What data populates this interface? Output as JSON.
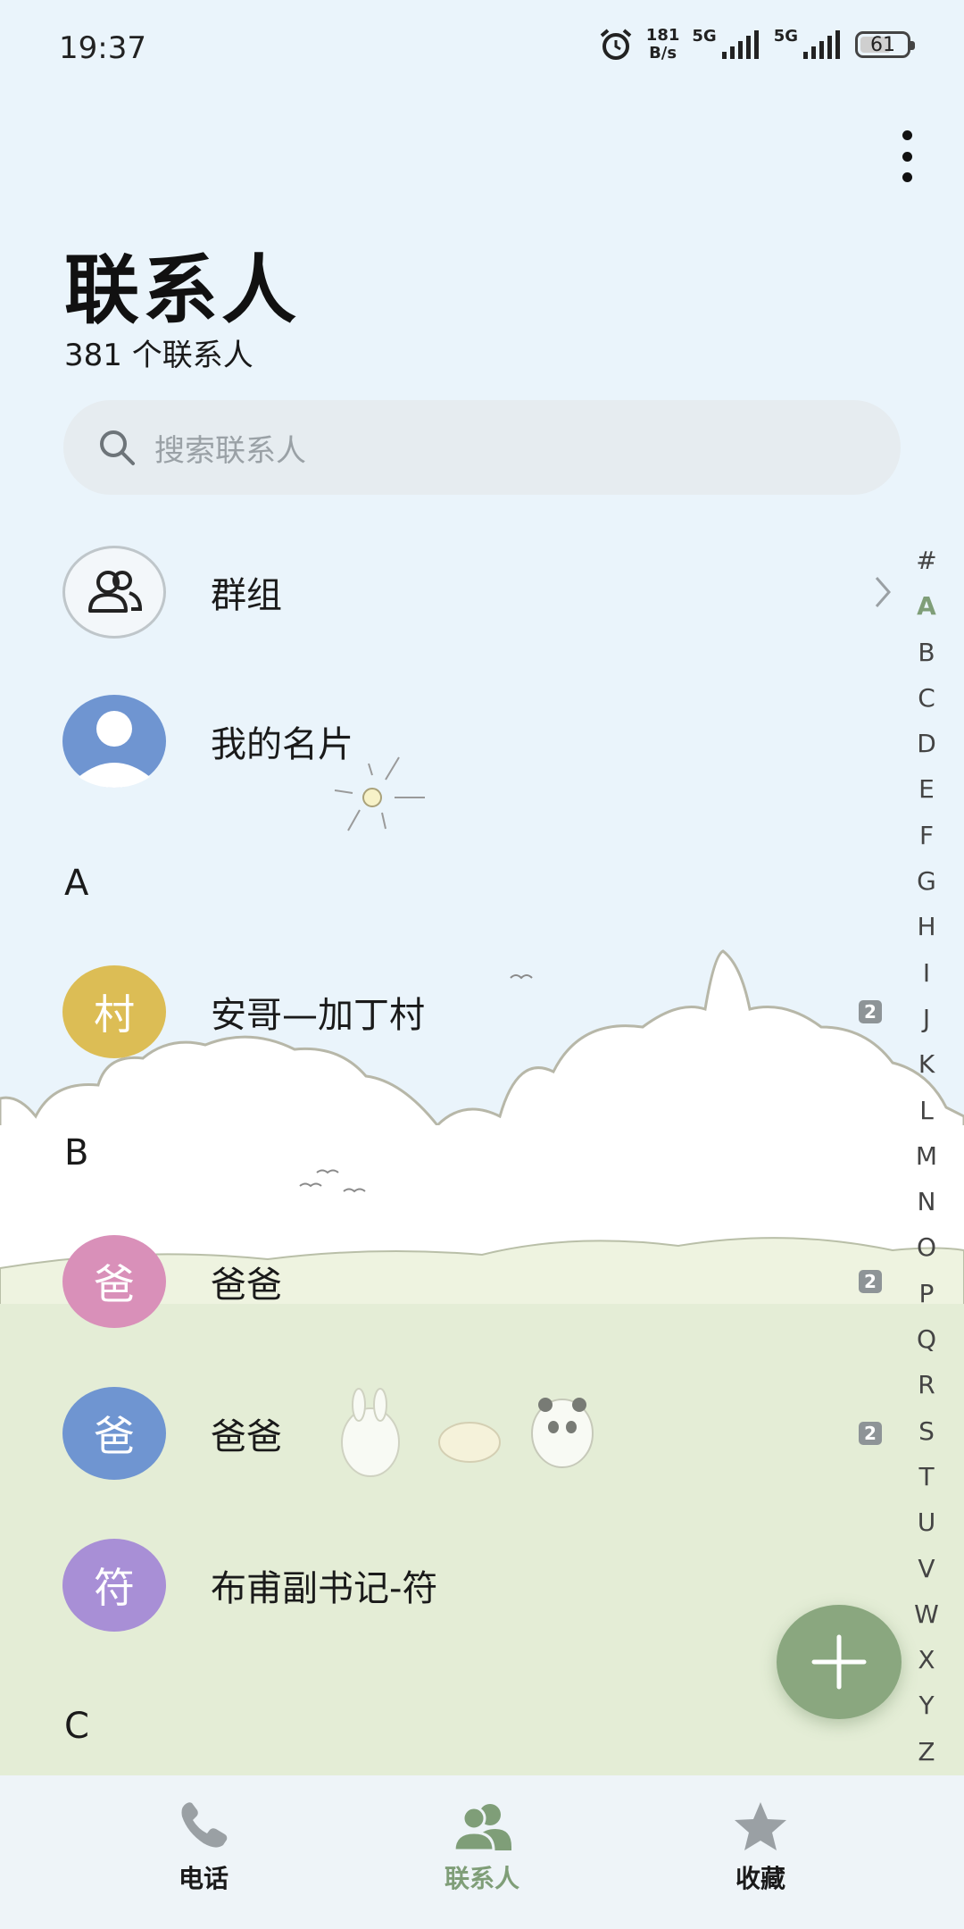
{
  "status_bar": {
    "time": "19:37",
    "net_speed_value": "181",
    "net_speed_unit": "B/s",
    "sim1_label": "5G",
    "sim2_label": "5G",
    "battery": "61"
  },
  "header": {
    "title": "联系人",
    "count": "381 个联系人",
    "more_icon": "more-vertical-icon"
  },
  "search": {
    "placeholder": "搜索联系人"
  },
  "special_rows": [
    {
      "label": "群组",
      "icon": "group-icon"
    },
    {
      "label": "我的名片",
      "icon": "person-icon"
    }
  ],
  "sections": [
    {
      "letter": "A"
    },
    {
      "letter": "B"
    },
    {
      "letter": "C"
    }
  ],
  "contacts": [
    {
      "avatar_char": "村",
      "name": "安哥—加丁村",
      "badge": "2",
      "color": "#dcbd55"
    },
    {
      "avatar_char": "爸",
      "name": "爸爸",
      "badge": "2",
      "color": "#d990b9"
    },
    {
      "avatar_char": "爸",
      "name": "爸爸",
      "badge": "2",
      "color": "#6f95d1"
    },
    {
      "avatar_char": "符",
      "name": "布甫副书记-符",
      "badge": "",
      "color": "#a88fd6"
    }
  ],
  "index_letters": [
    "#",
    "A",
    "B",
    "C",
    "D",
    "E",
    "F",
    "G",
    "H",
    "I",
    "J",
    "K",
    "L",
    "M",
    "N",
    "O",
    "P",
    "Q",
    "R",
    "S",
    "T",
    "U",
    "V",
    "W",
    "X",
    "Y",
    "Z"
  ],
  "index_active": "A",
  "bottom_nav": [
    {
      "label": "电话",
      "icon": "phone-icon"
    },
    {
      "label": "联系人",
      "icon": "contacts-icon"
    },
    {
      "label": "收藏",
      "icon": "star-icon"
    }
  ],
  "colors": {
    "accent": "#7f9e78",
    "background": "#eaf4fb",
    "grass": "#e4edd6"
  }
}
